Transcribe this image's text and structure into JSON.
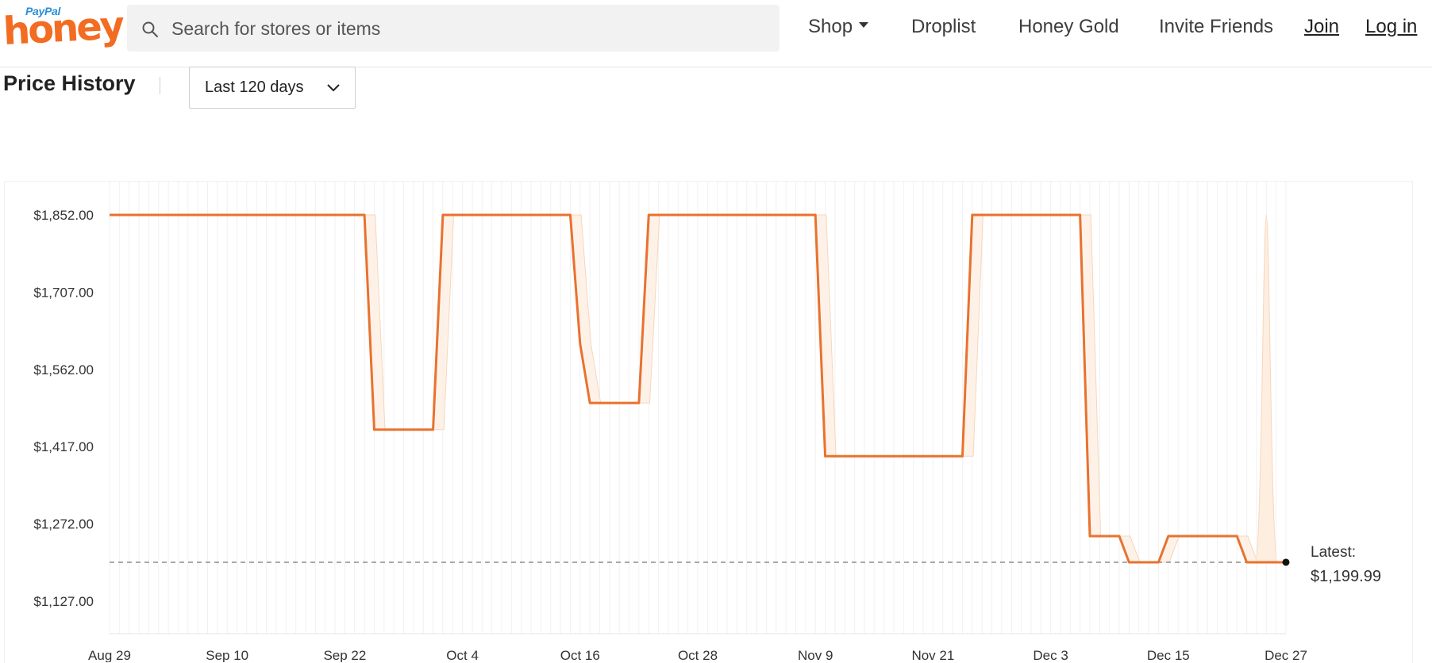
{
  "header": {
    "logo_paypal": "PayPal",
    "logo_honey": "honey",
    "search_placeholder": "Search for stores or items",
    "nav": {
      "shop": "Shop",
      "droplist": "Droplist",
      "honey_gold": "Honey Gold",
      "invite_friends": "Invite Friends",
      "join": "Join",
      "login": "Log in"
    }
  },
  "price_history": {
    "title": "Price History",
    "range_label": "Last 120 days"
  },
  "colors": {
    "brand": "#f26c22",
    "line": "#e8722f",
    "band": "#fdeee0"
  },
  "chart_data": {
    "type": "line",
    "title": "",
    "xlabel": "",
    "ylabel": "",
    "y_ticks": [
      "$1,852.00",
      "$1,707.00",
      "$1,562.00",
      "$1,417.00",
      "$1,272.00",
      "$1,127.00"
    ],
    "y_tick_values": [
      1852,
      1707,
      1562,
      1417,
      1272,
      1127
    ],
    "ylim": [
      1127,
      1852
    ],
    "x_ticks": [
      "Aug 29",
      "Sep 10",
      "Sep 22",
      "Oct 4",
      "Oct 16",
      "Oct 28",
      "Nov 9",
      "Nov 21",
      "Dec 3",
      "Dec 15",
      "Dec 27"
    ],
    "x_tick_dates": [
      "2024-08-29",
      "2024-09-10",
      "2024-09-22",
      "2024-10-04",
      "2024-10-16",
      "2024-10-28",
      "2024-11-09",
      "2024-11-21",
      "2024-12-03",
      "2024-12-15",
      "2024-12-27"
    ],
    "grid": "vertical",
    "series": [
      {
        "points": [
          [
            "2024-08-29",
            1852
          ],
          [
            "2024-09-24",
            1852
          ],
          [
            "2024-09-25",
            1449
          ],
          [
            "2024-10-01",
            1449
          ],
          [
            "2024-10-02",
            1852
          ],
          [
            "2024-10-15",
            1852
          ],
          [
            "2024-10-16",
            1610
          ],
          [
            "2024-10-17",
            1499
          ],
          [
            "2024-10-22",
            1499
          ],
          [
            "2024-10-23",
            1852
          ],
          [
            "2024-11-09",
            1852
          ],
          [
            "2024-11-10",
            1399
          ],
          [
            "2024-11-24",
            1399
          ],
          [
            "2024-11-25",
            1852
          ],
          [
            "2024-12-06",
            1852
          ],
          [
            "2024-12-07",
            1249
          ],
          [
            "2024-12-10",
            1249
          ],
          [
            "2024-12-11",
            1199.99
          ],
          [
            "2024-12-14",
            1199.99
          ],
          [
            "2024-12-15",
            1249
          ],
          [
            "2024-12-22",
            1249
          ],
          [
            "2024-12-23",
            1199.99
          ],
          [
            "2024-12-27",
            1199.99
          ]
        ]
      }
    ],
    "reference_line": 1199.99,
    "latest_label": "Latest:",
    "latest_value": "$1,199.99",
    "band_spike": {
      "date": "2024-12-25",
      "value": 1852
    }
  }
}
